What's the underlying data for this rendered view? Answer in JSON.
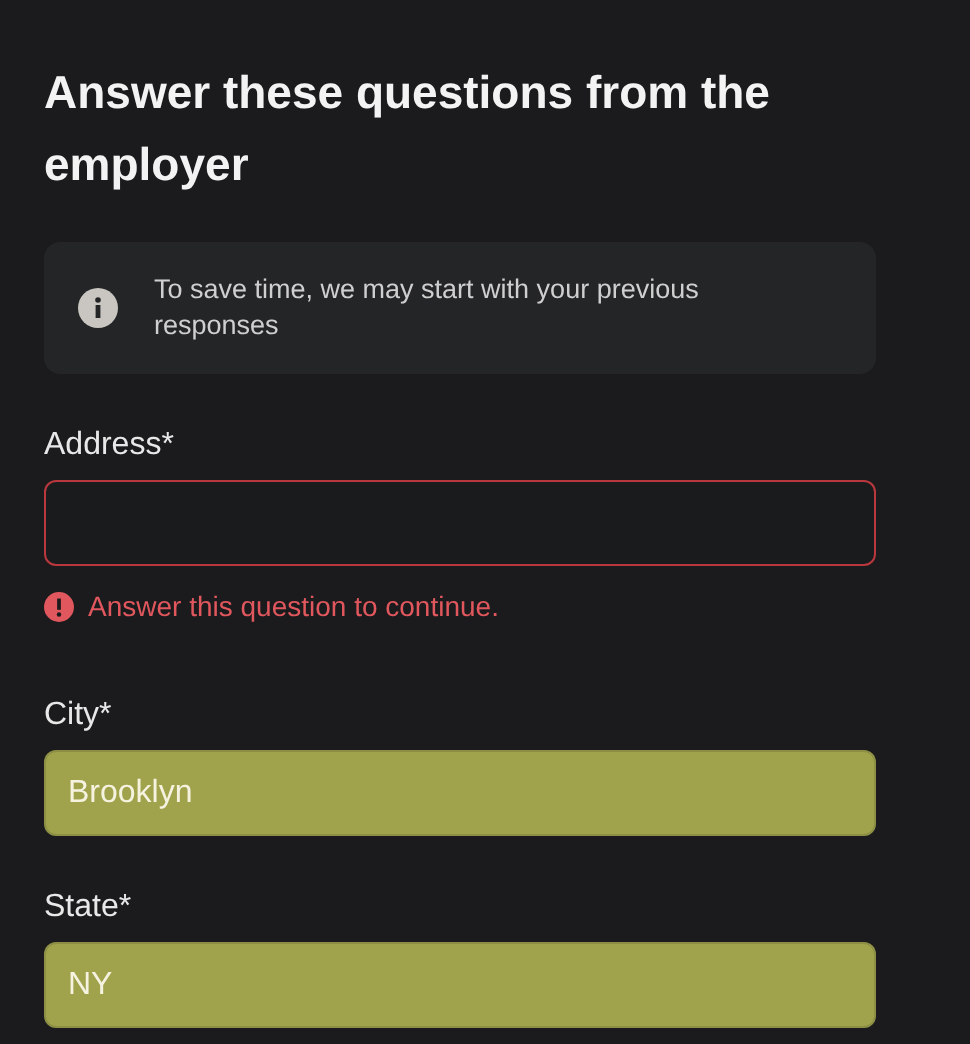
{
  "heading": "Answer these questions from the employer",
  "notice": {
    "text": "To save time, we may start with your previous responses"
  },
  "fields": [
    {
      "label": "Address*",
      "autofilled": false,
      "error": "Answer this question to continue."
    },
    {
      "label": "City*",
      "value": "Brooklyn",
      "autofilled": true
    },
    {
      "label": "State*",
      "value": "NY",
      "autofilled": true
    }
  ]
}
